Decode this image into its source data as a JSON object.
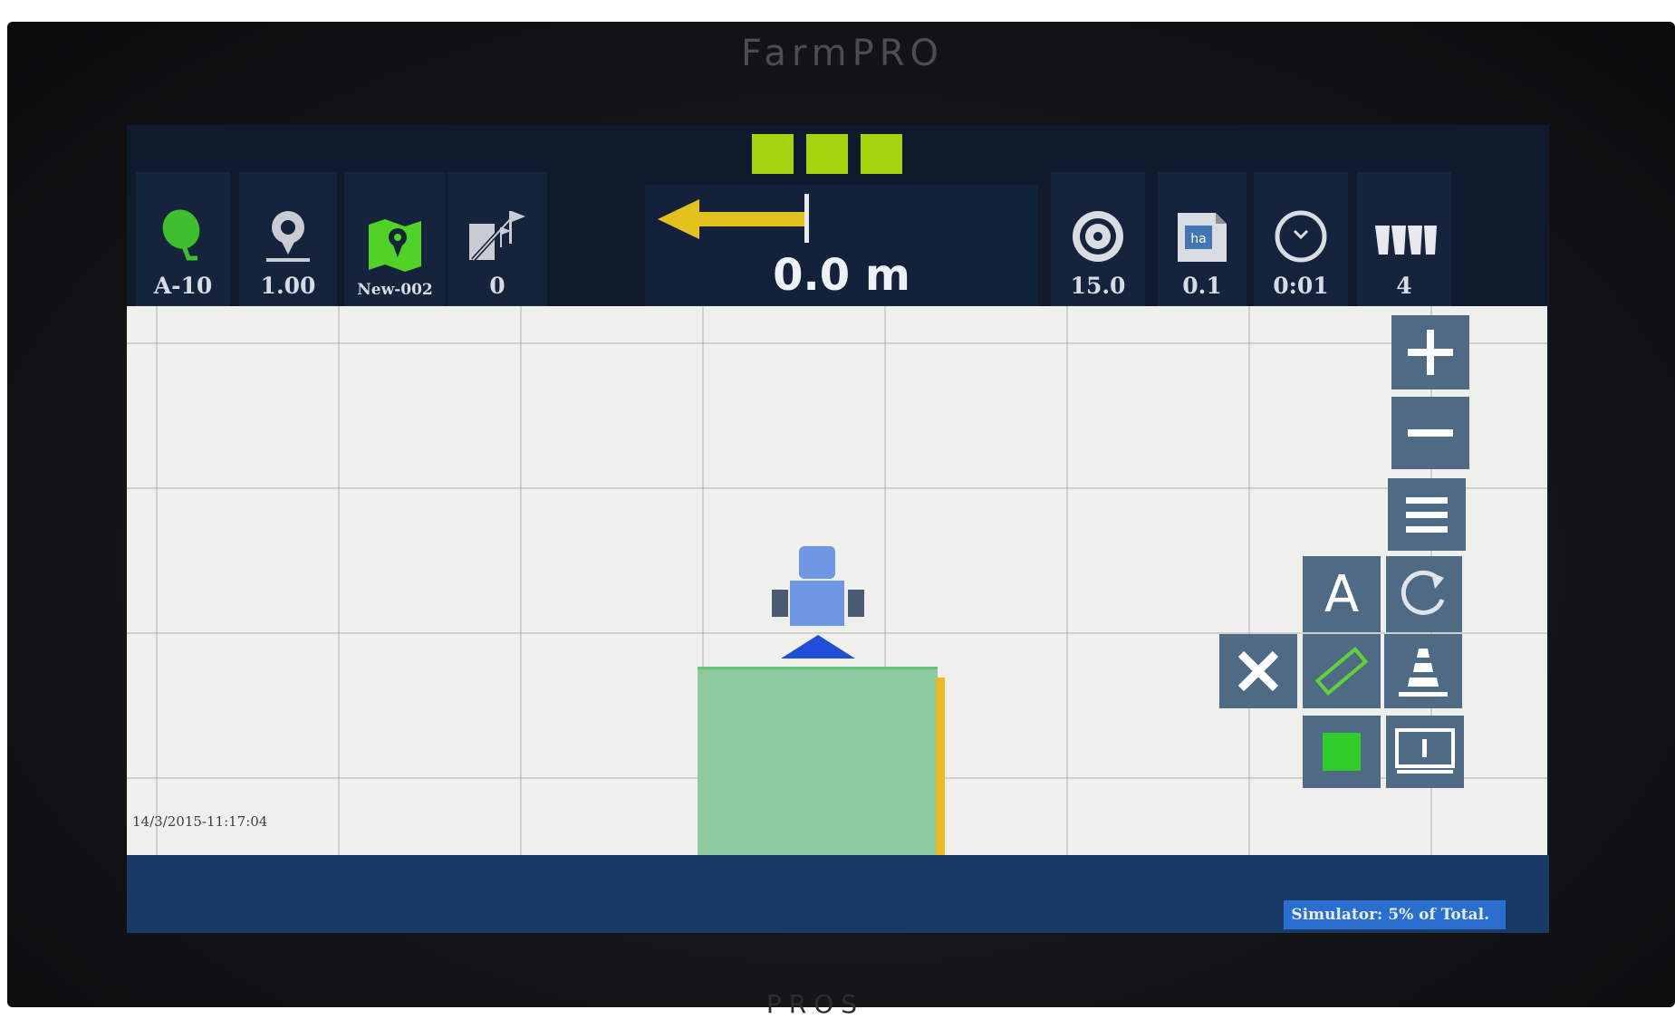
{
  "device": {
    "brand": "FarmPRO",
    "brand_bottom": "PROS"
  },
  "lightbar": {
    "lights": [
      "on",
      "on",
      "on"
    ],
    "color": "#a6d40c"
  },
  "toolbar": {
    "gps_status": {
      "icon": "satellite-dish-icon",
      "value": "A-10"
    },
    "accuracy": {
      "icon": "gps-pin-icon",
      "value": "1.00"
    },
    "field": {
      "icon": "field-map-icon",
      "value": "New-002"
    },
    "ab_line": {
      "icon": "ab-line-flag-icon",
      "value": "0"
    },
    "speed": {
      "icon": "speedometer-icon",
      "value": "15.0"
    },
    "area": {
      "icon": "hectare-icon",
      "value": "0.1"
    },
    "time": {
      "icon": "clock-icon",
      "value": "0:01"
    },
    "sections": {
      "icon": "boom-sections-icon",
      "value": "4"
    }
  },
  "guidance": {
    "cross_track_error": "0.0 m",
    "direction": "left",
    "arrow_color": "#e3c21e"
  },
  "map": {
    "timestamp": "14/3/2015-11:17:04",
    "coverage_color": "#8ccaa0",
    "boom_edge_color": "#f0b820"
  },
  "controls": {
    "zoom_in": "plus-icon",
    "zoom_out": "minus-icon",
    "menu": "menu-icon",
    "auto_label": "A",
    "rotate": "rotate-view-icon",
    "cancel": "close-icon",
    "measure": "ruler-icon",
    "view_3d": "perspective-icon",
    "record": "record-square-icon",
    "display": "display-icon"
  },
  "status": {
    "text": "Simulator: 5% of Total."
  }
}
